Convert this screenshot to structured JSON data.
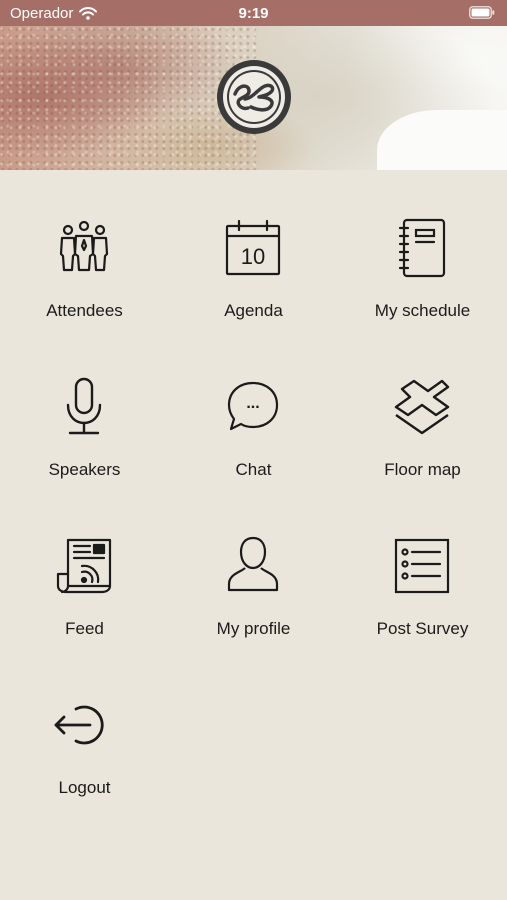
{
  "status_bar": {
    "carrier": "Operador",
    "time": "9:19",
    "wifi_icon": "wifi-icon",
    "battery_icon": "battery-icon"
  },
  "header": {
    "logo_icon": "event-logo-icon"
  },
  "menu": {
    "items": [
      {
        "label": "Attendees",
        "icon": "attendees-icon"
      },
      {
        "label": "Agenda",
        "icon": "calendar-icon",
        "calendar_day": "10"
      },
      {
        "label": "My schedule",
        "icon": "notebook-icon"
      },
      {
        "label": "Speakers",
        "icon": "microphone-icon"
      },
      {
        "label": "Chat",
        "icon": "chat-bubble-icon",
        "chat_glyph": "..."
      },
      {
        "label": "Floor map",
        "icon": "layers-icon"
      },
      {
        "label": "Feed",
        "icon": "rss-newspaper-icon"
      },
      {
        "label": "My profile",
        "icon": "user-icon"
      },
      {
        "label": "Post Survey",
        "icon": "list-icon"
      },
      {
        "label": "Logout",
        "icon": "logout-icon"
      }
    ]
  },
  "colors": {
    "status_bar": "#a56f67",
    "background": "#ebe6dc",
    "icon_stroke": "#1b1b1b"
  }
}
